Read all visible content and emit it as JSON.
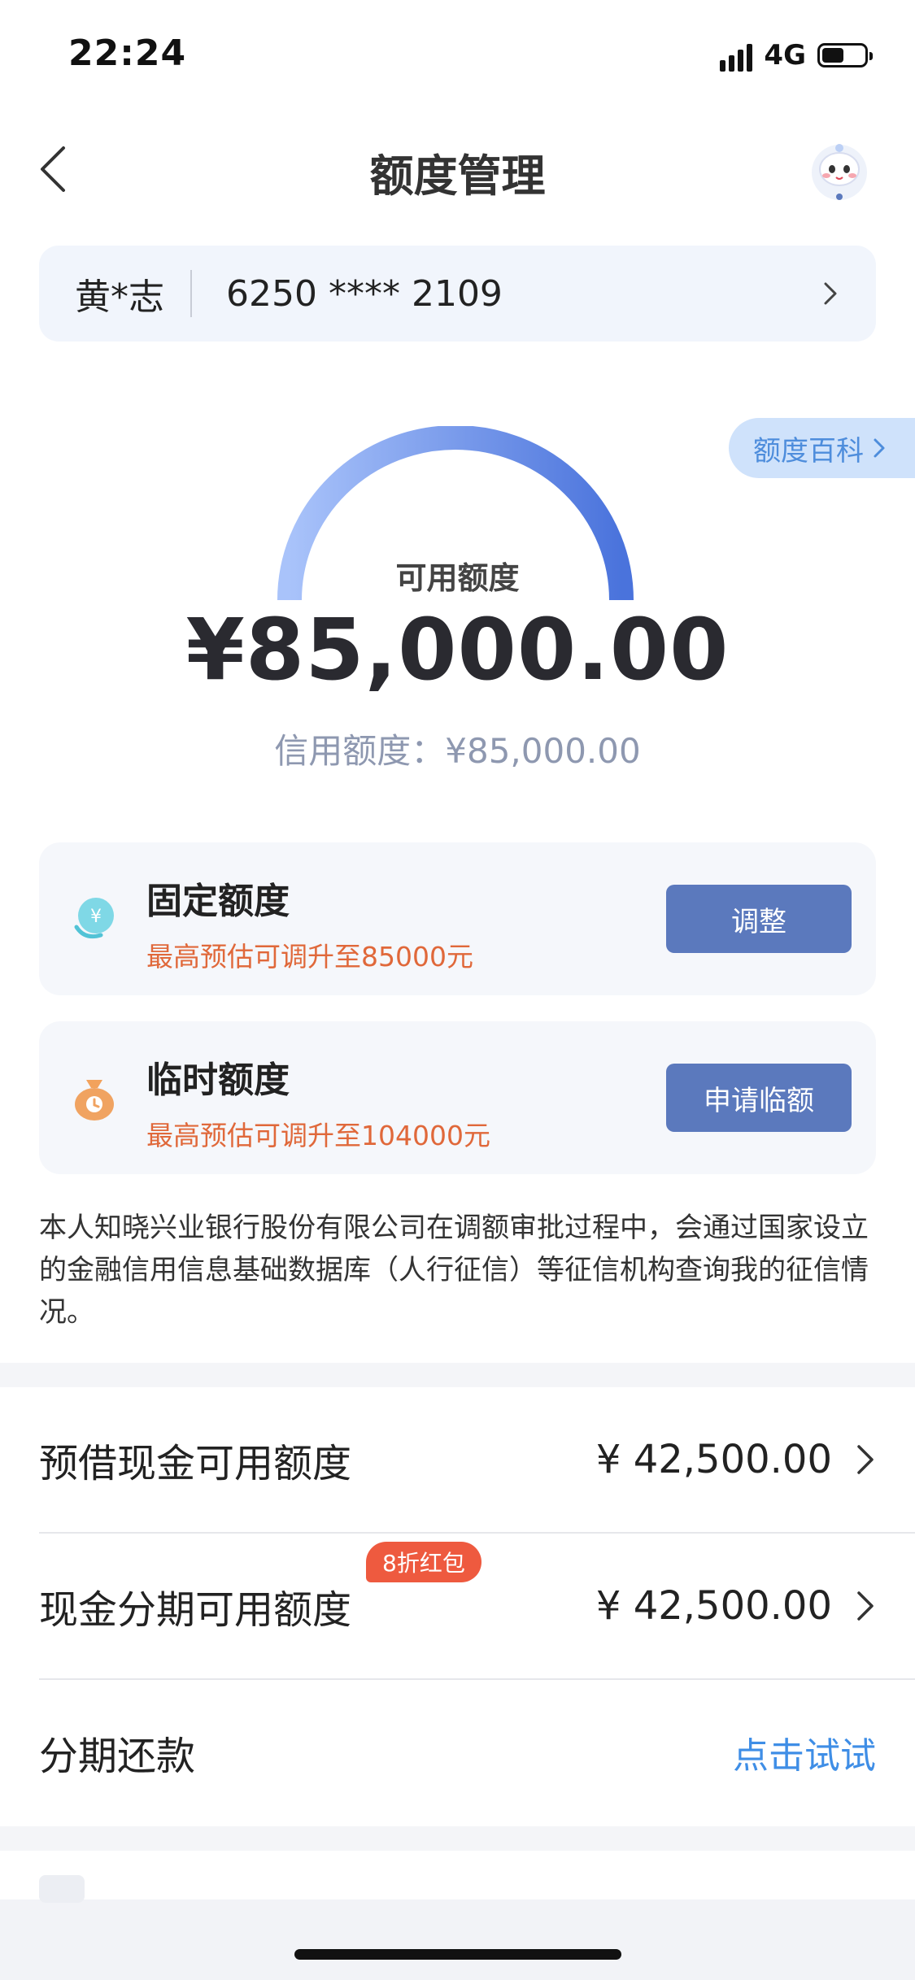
{
  "status_bar": {
    "time": "22:24",
    "network": "4G"
  },
  "nav": {
    "title": "额度管理"
  },
  "account": {
    "name": "黄*志",
    "card_number": "6250 **** 2109"
  },
  "wiki_label": "额度百科",
  "summary": {
    "available_label": "可用额度",
    "available_amount": "¥85,000.00",
    "credit_line": "信用额度：¥85,000.00"
  },
  "fixed_limit": {
    "title": "固定额度",
    "subtitle": "最高预估可调升至85000元",
    "button": "调整"
  },
  "temp_limit": {
    "title": "临时额度",
    "subtitle": "最高预估可调升至104000元",
    "button": "申请临额"
  },
  "notice": "本人知晓兴业银行股份有限公司在调额审批过程中，会通过国家设立的金融信用信息基础数据库（人行征信）等征信机构查询我的征信情况。",
  "list": {
    "cash_advance": {
      "label": "预借现金可用额度",
      "value": "¥ 42,500.00"
    },
    "cash_installment": {
      "label": "现金分期可用额度",
      "value": "¥ 42,500.00",
      "badge": "8折红包"
    },
    "installment_repay": {
      "label": "分期还款",
      "link": "点击试试"
    }
  },
  "colors": {
    "primary_button": "#5b79bd",
    "highlight_orange": "#e0683a",
    "link_blue": "#3f8ee6",
    "gauge_start": "#a9c3fa",
    "gauge_end": "#4a73dc"
  }
}
